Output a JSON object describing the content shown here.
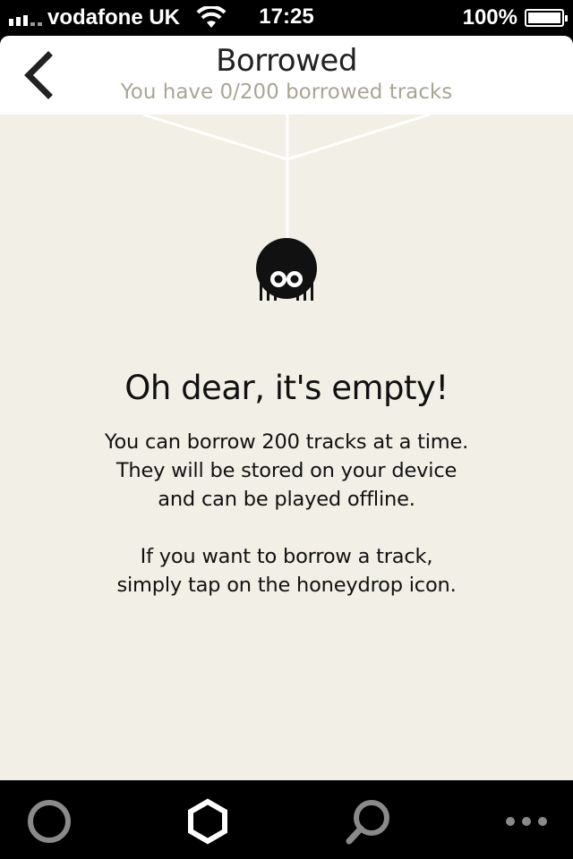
{
  "status_bar": {
    "carrier": "vodafone UK",
    "time": "17:25",
    "battery_percent": "100%",
    "battery_level": 1.0,
    "signal_icon": "signal-bars-icon",
    "wifi_icon": "wifi-icon",
    "battery_icon": "battery-icon"
  },
  "header": {
    "title": "Borrowed",
    "subtitle": "You have 0/200 borrowed tracks",
    "back_icon": "chevron-left-icon"
  },
  "empty_state": {
    "illustration": "spider-icon",
    "heading": "Oh dear, it's empty!",
    "paragraph1": [
      "You can borrow 200 tracks at a time.",
      "They will be stored on your device",
      "and can be played offline."
    ],
    "paragraph2": [
      "If you want to borrow a track,",
      "simply tap on the honeydrop icon."
    ]
  },
  "tab_bar": {
    "tabs": [
      {
        "icon": "circle-icon",
        "active": false
      },
      {
        "icon": "honeydrop-hexagon-icon",
        "active": true
      },
      {
        "icon": "search-icon",
        "active": false
      },
      {
        "icon": "more-dots-icon",
        "active": false
      }
    ]
  },
  "colors": {
    "background": "#f1efe6",
    "header_bg": "#ffffff",
    "subtitle": "#a9a595",
    "tab_inactive": "#8a8a8a",
    "tab_active": "#ffffff"
  }
}
